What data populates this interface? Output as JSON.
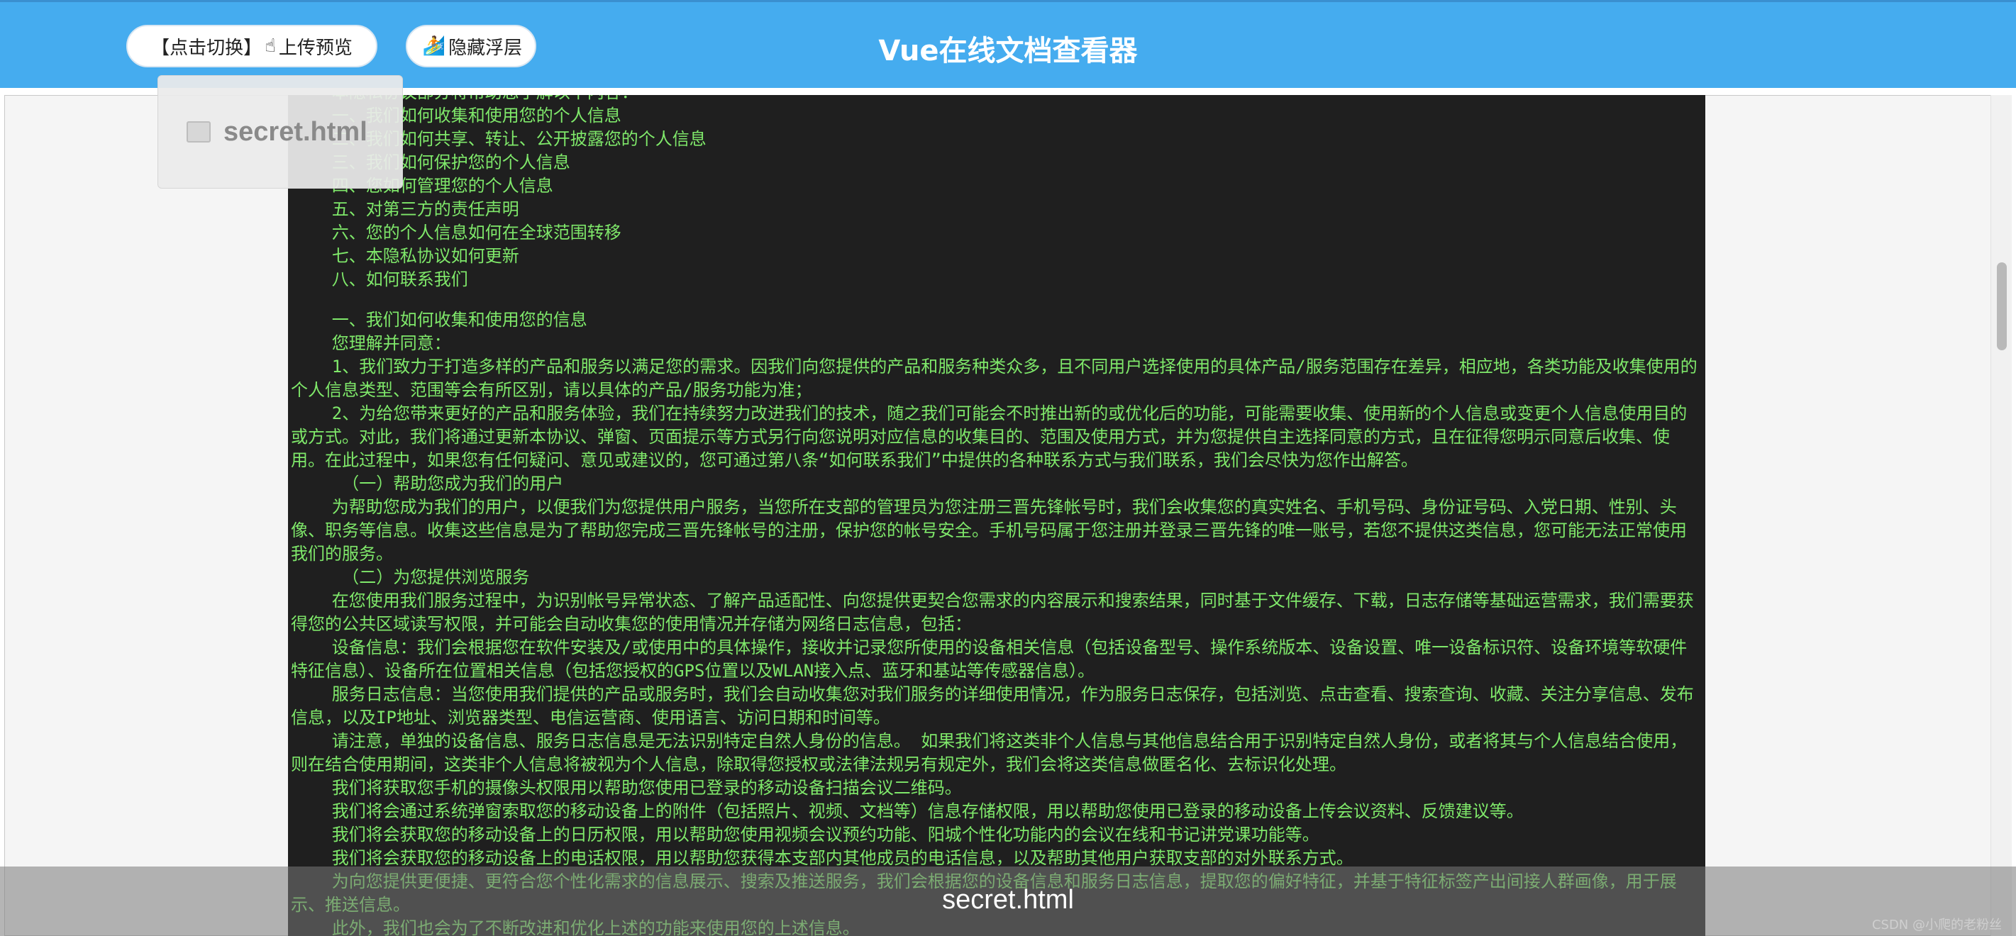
{
  "header": {
    "switch_label": "【点击切换】",
    "switch_icon": "☝",
    "switch_upload_label": "上传预览",
    "hide_icon": "🏄",
    "hide_label": "隐藏浮层",
    "title": "Vue在线文档查看器",
    "bg_color": "#45acef"
  },
  "file_chip": {
    "name": "secret.html",
    "icon": "document-icon"
  },
  "bottom_bar": {
    "filename": "secret.html"
  },
  "watermark": "CSDN @小爬的老粉丝",
  "document": {
    "bg_color": "#1f1f1f",
    "text_color": "#7fe86a",
    "paragraphs": [
      "    本隐私协议部分将帮助您了解以下内容：",
      "    一、我们如何收集和使用您的个人信息",
      "    二、我们如何共享、转让、公开披露您的个人信息",
      "    三、我们如何保护您的个人信息",
      "    四、您如何管理您的个人信息",
      "    五、对第三方的责任声明",
      "    六、您的个人信息如何在全球范围转移",
      "    七、本隐私协议如何更新",
      "    八、如何联系我们",
      "",
      "    一、我们如何收集和使用您的信息",
      "    您理解并同意：",
      "    1、我们致力于打造多样的产品和服务以满足您的需求。因我们向您提供的产品和服务种类众多，且不同用户选择使用的具体产品/服务范围存在差异，相应地，各类功能及收集使用的个人信息类型、范围等会有所区别，请以具体的产品/服务功能为准；",
      "    2、为给您带来更好的产品和服务体验，我们在持续努力改进我们的技术，随之我们可能会不时推出新的或优化后的功能，可能需要收集、使用新的个人信息或变更个人信息使用目的或方式。对此，我们将通过更新本协议、弹窗、页面提示等方式另行向您说明对应信息的收集目的、范围及使用方式，并为您提供自主选择同意的方式，且在征得您明示同意后收集、使用。在此过程中，如果您有任何疑问、意见或建议的，您可通过第八条“如何联系我们”中提供的各种联系方式与我们联系，我们会尽快为您作出解答。",
      "     （一）帮助您成为我们的用户",
      "    为帮助您成为我们的用户，以便我们为您提供用户服务，当您所在支部的管理员为您注册三晋先锋帐号时，我们会收集您的真实姓名、手机号码、身份证号码、入党日期、性别、头像、职务等信息。收集这些信息是为了帮助您完成三晋先锋帐号的注册，保护您的帐号安全。手机号码属于您注册并登录三晋先锋的唯一账号，若您不提供这类信息，您可能无法正常使用我们的服务。",
      "     （二）为您提供浏览服务",
      "    在您使用我们服务过程中，为识别帐号异常状态、了解产品适配性、向您提供更契合您需求的内容展示和搜索结果，同时基于文件缓存、下载，日志存储等基础运营需求，我们需要获得您的公共区域读写权限，并可能会自动收集您的使用情况并存储为网络日志信息，包括：",
      "    设备信息：我们会根据您在软件安装及/或使用中的具体操作，接收并记录您所使用的设备相关信息（包括设备型号、操作系统版本、设备设置、唯一设备标识符、设备环境等软硬件特征信息）、设备所在位置相关信息（包括您授权的GPS位置以及WLAN接入点、蓝牙和基站等传感器信息）。",
      "    服务日志信息：当您使用我们提供的产品或服务时，我们会自动收集您对我们服务的详细使用情况，作为服务日志保存，包括浏览、点击查看、搜索查询、收藏、关注分享信息、发布信息，以及IP地址、浏览器类型、电信运营商、使用语言、访问日期和时间等。",
      "    请注意，单独的设备信息、服务日志信息是无法识别特定自然人身份的信息。 如果我们将这类非个人信息与其他信息结合用于识别特定自然人身份，或者将其与个人信息结合使用，则在结合使用期间，这类非个人信息将被视为个人信息，除取得您授权或法律法规另有规定外，我们会将这类信息做匿名化、去标识化处理。",
      "    我们将获取您手机的摄像头权限用以帮助您使用已登录的移动设备扫描会议二维码。",
      "    我们将会通过系统弹窗索取您的移动设备上的附件（包括照片、视频、文档等）信息存储权限，用以帮助您使用已登录的移动设备上传会议资料、反馈建议等。",
      "    我们将会获取您的移动设备上的日历权限，用以帮助您使用视频会议预约功能、阳城个性化功能内的会议在线和书记讲党课功能等。",
      "    我们将会获取您的移动设备上的电话权限，用以帮助您获得本支部内其他成员的电话信息，以及帮助其他用户获取支部的对外联系方式。",
      "    为向您提供更便捷、更符合您个性化需求的信息展示、搜索及推送服务，我们会根据您的设备信息和服务日志信息，提取您的偏好特征，并基于特征标签产出间接人群画像，用于展示、推送信息。",
      "    此外，我们也会为了不断改进和优化上述的功能来使用您的上述信息。"
    ]
  }
}
